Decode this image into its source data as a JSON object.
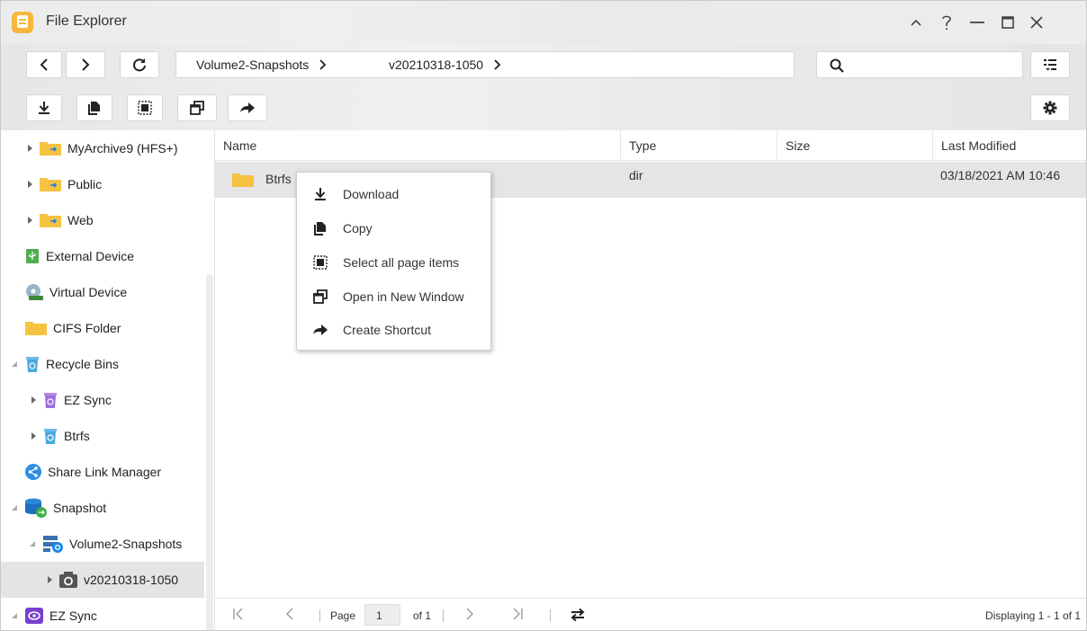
{
  "window": {
    "title": "File Explorer",
    "controls": [
      "collapse",
      "help",
      "minimize",
      "maximize",
      "close"
    ]
  },
  "toolbar": {
    "back": "chevron-left-icon",
    "forward": "chevron-right-icon",
    "refresh": "refresh-icon",
    "breadcrumb": [
      {
        "label": "Volume2-Snapshots"
      },
      {
        "label": "v20210318-1050"
      }
    ],
    "search": {
      "value": "",
      "placeholder": ""
    },
    "actions": [
      "download-icon",
      "copy-icon",
      "select-all-icon",
      "open-new-window-icon",
      "create-shortcut-icon"
    ]
  },
  "sidebar": {
    "items": [
      {
        "label": "MyArchive9 (HFS+)",
        "icon": "shared-folder-icon",
        "expander": "collapsed"
      },
      {
        "label": "Public",
        "icon": "shared-folder-icon",
        "expander": "collapsed"
      },
      {
        "label": "Web",
        "icon": "shared-folder-icon",
        "expander": "collapsed"
      },
      {
        "label": "External Device",
        "icon": "usb-device-icon",
        "expander": "none"
      },
      {
        "label": "Virtual Device",
        "icon": "virtual-disc-icon",
        "expander": "none"
      },
      {
        "label": "CIFS Folder",
        "icon": "folder-icon",
        "expander": "none"
      },
      {
        "label": "Recycle Bins",
        "icon": "recycle-bin-icon",
        "expander": "expanded"
      },
      {
        "label": "EZ Sync",
        "icon": "recycle-bin-icon",
        "expander": "collapsed"
      },
      {
        "label": "Btrfs",
        "icon": "recycle-bin-icon",
        "expander": "collapsed"
      },
      {
        "label": "Share Link Manager",
        "icon": "share-link-icon",
        "expander": "none"
      },
      {
        "label": "Snapshot",
        "icon": "snapshot-db-icon",
        "expander": "expanded"
      },
      {
        "label": "Volume2-Snapshots",
        "icon": "snapshot-volume-icon",
        "expander": "expanded"
      },
      {
        "label": "v20210318-1050",
        "icon": "camera-icon",
        "expander": "collapsed",
        "selected": true
      },
      {
        "label": "EZ Sync",
        "icon": "ez-sync-icon",
        "expander": "expanded"
      }
    ]
  },
  "table": {
    "columns": [
      "Name",
      "Type",
      "Size",
      "Last Modified"
    ],
    "rows": [
      {
        "name": "Btrfs",
        "type": "dir",
        "size": "",
        "modified": "03/18/2021 AM 10:46"
      }
    ]
  },
  "context_menu": {
    "items": [
      {
        "label": "Download",
        "icon": "download-icon"
      },
      {
        "label": "Copy",
        "icon": "copy-icon"
      },
      {
        "label": "Select all page items",
        "icon": "select-all-icon"
      },
      {
        "label": "Open in New Window",
        "icon": "open-new-window-icon"
      },
      {
        "label": "Create Shortcut",
        "icon": "create-shortcut-icon"
      }
    ]
  },
  "pager": {
    "page_label": "Page",
    "page_value": "1",
    "of_label": "of 1",
    "status": "Displaying 1 - 1 of 1"
  },
  "colors": {
    "folder": "#f5c242",
    "recycle": "#4aa8e0",
    "accent_purple": "#7a3fd1",
    "selection": "#e4e4e4"
  }
}
